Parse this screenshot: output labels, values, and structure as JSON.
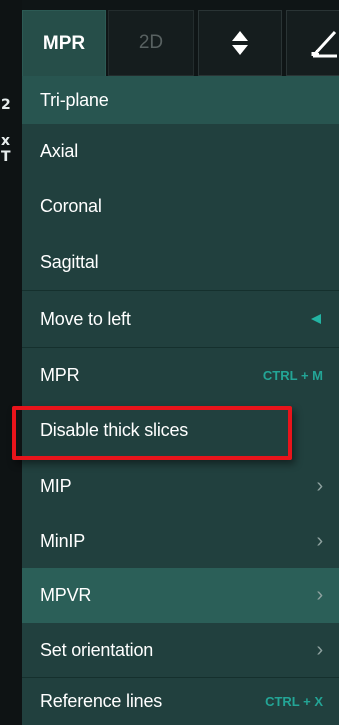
{
  "toolbar": {
    "mpr_label": "MPR",
    "twod_label": "2D",
    "arrows_icon": "up-down-arrows-icon",
    "ruler_icon": "ruler-icon"
  },
  "left_strip": {
    "chars": [
      "2",
      "x",
      "T"
    ]
  },
  "menu": {
    "items": [
      {
        "label": "Tri-plane",
        "state": "active"
      },
      {
        "label": "Axial"
      },
      {
        "label": "Coronal"
      },
      {
        "label": "Sagittal"
      },
      {
        "label": "Move to left",
        "indicator": "triangle-left-icon"
      },
      {
        "label": "MPR",
        "shortcut": "CTRL + M"
      },
      {
        "label": "Disable thick slices",
        "annotated": true
      },
      {
        "label": "MIP",
        "submenu": true
      },
      {
        "label": "MinIP",
        "submenu": true
      },
      {
        "label": "MPVR",
        "submenu": true,
        "state": "hover"
      },
      {
        "label": "Set orientation",
        "submenu": true
      },
      {
        "label": "Reference lines",
        "shortcut": "CTRL + X"
      }
    ],
    "chevron_glyph": "›"
  },
  "colors": {
    "menu_bg": "#21403e",
    "active_bg": "#285550",
    "shortcut": "#23a596",
    "annotation": "#e8141b"
  }
}
